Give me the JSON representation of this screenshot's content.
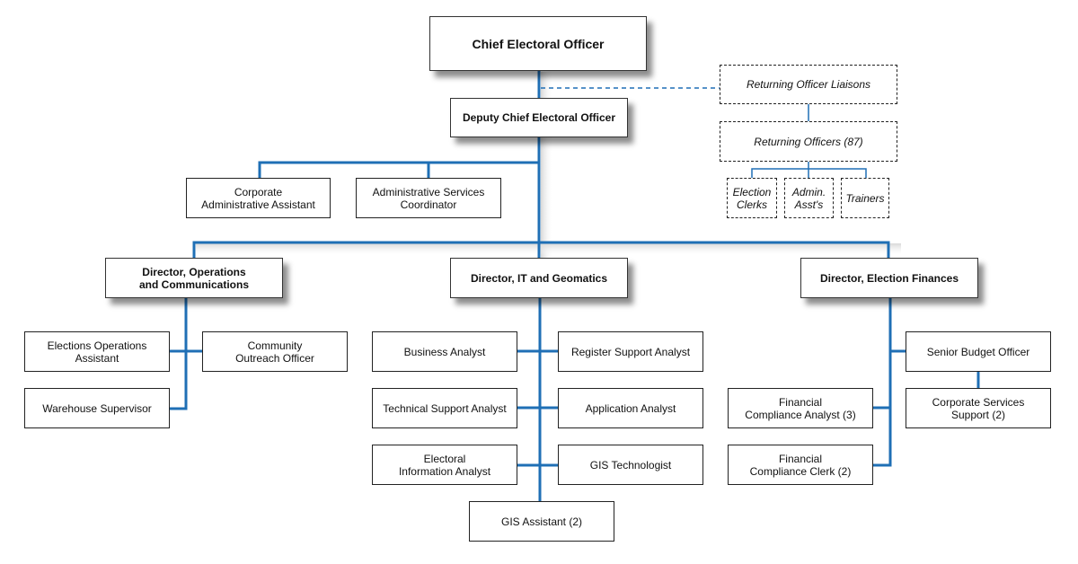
{
  "connector_color": "#1f6fb5",
  "top": {
    "title": "Chief Electoral Officer"
  },
  "deputy": {
    "title": "Deputy Chief Electoral Officer"
  },
  "returning": {
    "liaisons": "Returning Officer Liaisons",
    "officers": "Returning Officers (87)",
    "staff": [
      "Election\nClerks",
      "Admin.\nAsst's",
      "Trainers"
    ]
  },
  "deputy_staff": [
    "Corporate\nAdministrative Assistant",
    "Administrative Services\nCoordinator"
  ],
  "directors": {
    "operations": {
      "title": "Director, Operations\nand Communications",
      "staff": [
        "Elections Operations\nAssistant",
        "Community\nOutreach Officer",
        "Warehouse Supervisor"
      ]
    },
    "it": {
      "title": "Director, IT and Geomatics",
      "staff": [
        "Business Analyst",
        "Register Support Analyst",
        "Technical Support Analyst",
        "Application Analyst",
        "Electoral\nInformation Analyst",
        "GIS Technologist",
        "GIS Assistant (2)"
      ]
    },
    "finance": {
      "title": "Director, Election Finances",
      "staff": [
        "Senior Budget Officer",
        "Corporate Services\nSupport (2)",
        "Financial\nCompliance Analyst (3)",
        "Financial\nCompliance Clerk (2)"
      ]
    }
  }
}
